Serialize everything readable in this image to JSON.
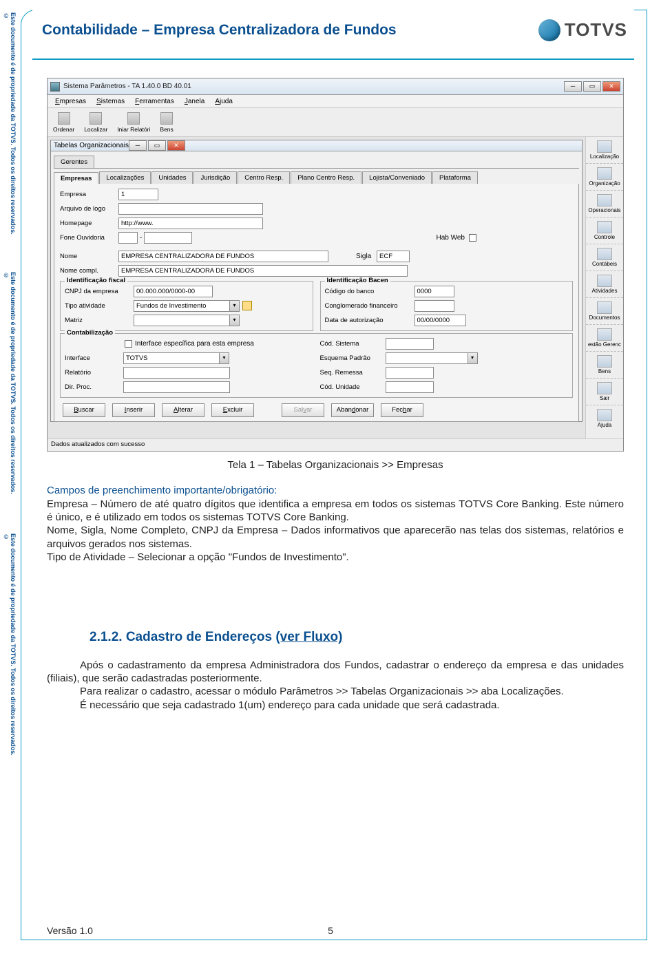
{
  "side_text": "Este documento é de propriedade da TOTVS. Todos os direitos reservados. ©",
  "header": {
    "title": "Contabilidade – Empresa Centralizadora de Fundos",
    "brand": "TOTVS"
  },
  "screenshot": {
    "outer_title": "Sistema Parâmetros - TA 1.40.0 BD 40.01",
    "menu": [
      "Empresas",
      "Sistemas",
      "Ferramentas",
      "Janela",
      "Ajuda"
    ],
    "toolbar": [
      {
        "label": "Ordenar"
      },
      {
        "label": "Localizar"
      },
      {
        "label": "Iniar Relatóri"
      },
      {
        "label": "Bens"
      }
    ],
    "right_strip": [
      "Localização",
      "Organização",
      "Operacionais",
      "Controle",
      "Contábeis",
      "Atividades",
      "Documentos",
      "estão Gerenc",
      "Bens",
      "Sair",
      "Ajuda"
    ],
    "inner_title": "Tabelas Organizacionais",
    "tabs": [
      "Gerentes",
      "Empresas",
      "Localizações",
      "Unidades",
      "Jurisdição",
      "Centro Resp.",
      "Plano Centro Resp.",
      "Lojista/Conveniado",
      "Plataforma"
    ],
    "active_tab": "Empresas",
    "form": {
      "empresa": {
        "label": "Empresa",
        "value": "1"
      },
      "arquivo": {
        "label": "Arquivo de logo",
        "value": ""
      },
      "homepage": {
        "label": "Homepage",
        "value": "http://www."
      },
      "fone": {
        "label": "Fone Ouvidoria",
        "v1": "",
        "v2": ""
      },
      "habweb": {
        "label": "Hab Web"
      },
      "nome": {
        "label": "Nome",
        "value": "EMPRESA CENTRALIZADORA DE FUNDOS"
      },
      "sigla": {
        "label": "Sigla",
        "value": "ECF"
      },
      "nomec": {
        "label": "Nome compl.",
        "value": "EMPRESA CENTRALIZADORA DE FUNDOS"
      },
      "fiscal": {
        "legend": "Identificação fiscal",
        "cnpj": {
          "label": "CNPJ da empresa",
          "value": "00.000.000/0000-00"
        },
        "tipo": {
          "label": "Tipo atividade",
          "value": "Fundos de Investimento"
        },
        "matriz": {
          "label": "Matriz",
          "value": ""
        }
      },
      "bacen": {
        "legend": "Identificação Bacen",
        "cod": {
          "label": "Código do banco",
          "value": "0000"
        },
        "cong": {
          "label": "Conglomerado financeiro",
          "value": ""
        },
        "data": {
          "label": "Data de autorização",
          "value": "00/00/0000"
        }
      },
      "contab": {
        "legend": "Contabilização",
        "chk": "Interface específica para esta empresa",
        "interface": {
          "label": "Interface",
          "value": "TOTVS"
        },
        "relatorio": {
          "label": "Relatório",
          "value": ""
        },
        "dir": {
          "label": "Dir. Proc.",
          "value": ""
        },
        "codsis": {
          "label": "Cód. Sistema",
          "value": ""
        },
        "esquema": {
          "label": "Esquema Padrão",
          "value": ""
        },
        "seq": {
          "label": "Seq. Remessa",
          "value": ""
        },
        "codun": {
          "label": "Cód. Unidade",
          "value": ""
        }
      }
    },
    "buttons": [
      "Buscar",
      "Inserir",
      "Alterar",
      "Excluir",
      "Salvar",
      "Abandonar",
      "Fechar"
    ],
    "disabled_buttons": [
      "Salvar"
    ],
    "status": "Dados atualizados com sucesso"
  },
  "caption": "Tela 1 – Tabelas Organizacionais >> Empresas",
  "text": {
    "intro": "Campos de preenchimento importante/obrigatório:",
    "p1": "Empresa – Número de até quatro dígitos que identifica a empresa em todos os sistemas TOTVS Core Banking. Este número é único, e é utilizado em todos os sistemas TOTVS Core Banking.",
    "p2": "Nome, Sigla, Nome Completo, CNPJ da Empresa – Dados informativos que aparecerão nas telas dos sistemas, relatórios e arquivos gerados nos sistemas.",
    "p3": "Tipo de Atividade – Selecionar a opção \"Fundos de Investimento\"."
  },
  "heading": {
    "num": "2.1.2.",
    "title": "Cadastro de Endereços ",
    "link": "(ver Fluxo)"
  },
  "text2": {
    "p1": "Após o cadastramento da empresa Administradora dos Fundos, cadastrar o endereço da empresa e das unidades (filiais), que serão cadastradas posteriormente.",
    "p2": "Para realizar o cadastro, acessar o módulo Parâmetros >> Tabelas Organizacionais >> aba Localizações.",
    "p3": "É necessário que seja cadastrado 1(um) endereço para cada unidade que será cadastrada."
  },
  "footer": {
    "version": "Versão 1.0",
    "page": "5"
  }
}
